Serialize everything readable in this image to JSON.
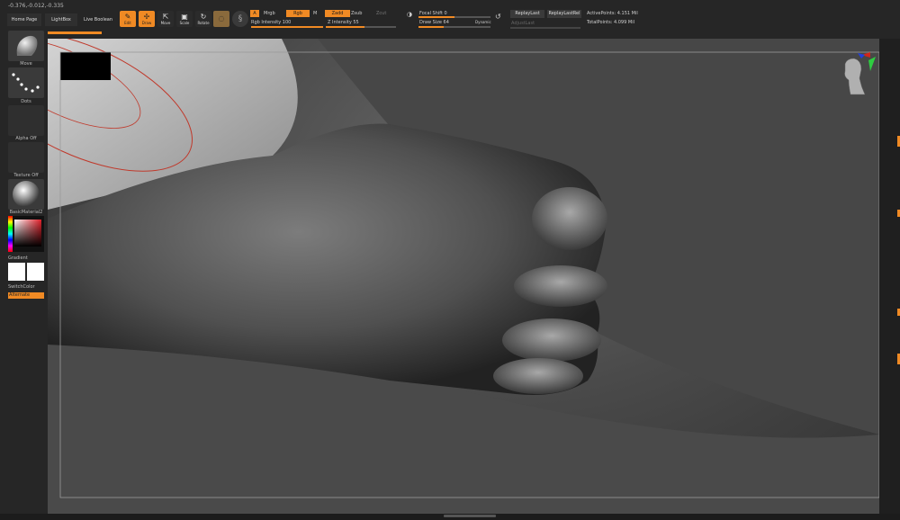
{
  "coords": "-0.376,-0.012,-0.335",
  "nav": {
    "home": "Home Page",
    "lightbox": "LightBox",
    "live_boolean": "Live Boolean"
  },
  "tools": {
    "edit": "Edit",
    "draw": "Draw",
    "move": "Move",
    "scale": "Scale",
    "rotate": "Rotate"
  },
  "brush": {
    "a_label": "A",
    "mrgb": "Mrgb",
    "rgb": "Rgb",
    "m": "M",
    "rgb_intensity_label": "Rgb Intensity",
    "rgb_intensity": "100",
    "zadd": "Zadd",
    "zsub": "Zsub",
    "zcut": "Zcut",
    "z_intensity_label": "Z Intensity",
    "z_intensity": "55",
    "focal_shift_label": "Focal Shift",
    "focal_shift": "0",
    "draw_size_label": "Draw Size",
    "draw_size": "64",
    "dynamic": "Dynamic",
    "focal_shift_fraction": 0.5,
    "draw_size_fraction": 0.35,
    "rgb_intensity_fraction": 1.0,
    "z_intensity_fraction": 0.55
  },
  "replay": {
    "replay_last": "ReplayLast",
    "replay_last_rel": "ReplayLastRel",
    "adjust_last": "AdjustLast"
  },
  "stats": {
    "active_points_label": "ActivePoints:",
    "active_points": "4.151 Mil",
    "total_points_label": "TotalPoints:",
    "total_points": "4.099 Mil"
  },
  "left_panel": {
    "move": "Move",
    "dots": "Dots",
    "alpha": "Alpha Off",
    "texture": "Texture Off",
    "material": "BasicMaterial2",
    "gradient": "Gradient",
    "switch_color": "SwitchColor",
    "alternate": "Alternate"
  },
  "colors": {
    "accent": "#f08a24",
    "toolbar_bg": "#262626",
    "tile_bg": "#3a3a3a"
  }
}
